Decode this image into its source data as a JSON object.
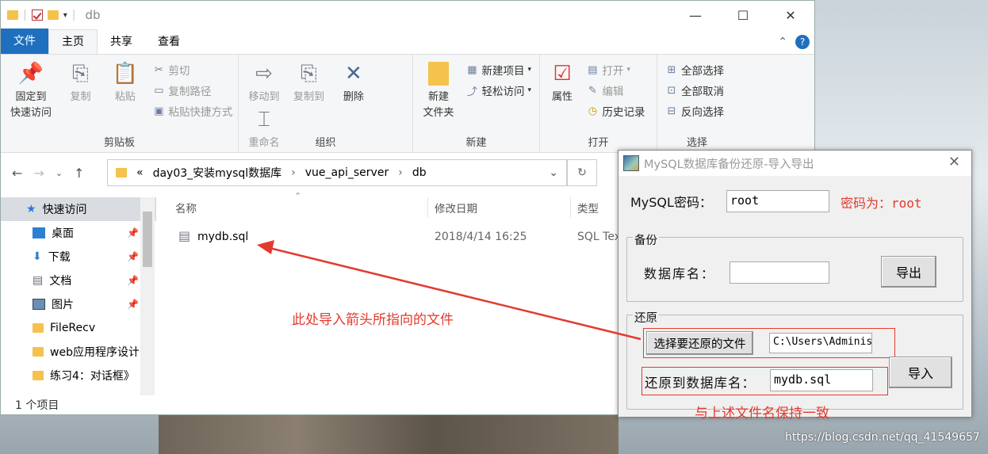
{
  "window": {
    "title": "db",
    "minimize": "—",
    "maximize": "☐",
    "close": "✕"
  },
  "ribbon_tabs": [
    "文件",
    "主页",
    "共享",
    "查看"
  ],
  "clipboard": {
    "pin": "固定到\n快速访问",
    "copy": "复制",
    "paste": "粘贴",
    "cut": "剪切",
    "copy_path": "复制路径",
    "paste_shortcut": "粘贴快捷方式",
    "label": "剪贴板"
  },
  "organize": {
    "move_to": "移动到",
    "copy_to": "复制到",
    "delete": "删除",
    "rename": "重命名",
    "label": "组织"
  },
  "new": {
    "new_folder": "新建\n文件夹",
    "new_item": "新建项目",
    "easy_access": "轻松访问",
    "label": "新建"
  },
  "open": {
    "properties": "属性",
    "open": "打开",
    "edit": "编辑",
    "history": "历史记录",
    "label": "打开"
  },
  "select": {
    "select_all": "全部选择",
    "select_none": "全部取消",
    "invert": "反向选择",
    "label": "选择"
  },
  "address": {
    "prefix": "«",
    "segments": [
      "day03_安装mysql数据库",
      "vue_api_server",
      "db"
    ]
  },
  "sidebar": [
    {
      "label": "快速访问",
      "icon": "star-icon",
      "pinned": false
    },
    {
      "label": "桌面",
      "icon": "desktop-icon",
      "pinned": true
    },
    {
      "label": "下载",
      "icon": "download-icon",
      "pinned": true
    },
    {
      "label": "文档",
      "icon": "document-icon",
      "pinned": true
    },
    {
      "label": "图片",
      "icon": "picture-icon",
      "pinned": true
    },
    {
      "label": "FileRecv",
      "icon": "folder-icon",
      "pinned": false
    },
    {
      "label": "web应用程序设计",
      "icon": "folder-icon",
      "pinned": false
    },
    {
      "label": "练习4：对话框》",
      "icon": "folder-icon",
      "pinned": false
    }
  ],
  "columns": {
    "name": "名称",
    "modified": "修改日期",
    "type": "类型"
  },
  "files": [
    {
      "name": "mydb.sql",
      "modified": "2018/4/14 16:25",
      "type": "SQL Tex"
    }
  ],
  "status": "1 个项目",
  "dialog": {
    "title": "MySQL数据库备份还原-导入导出",
    "password_label": "MySQL密码：",
    "password_value": "root",
    "password_note": "密码为：root",
    "backup_group": "备份",
    "db_name_label": "数据库名：",
    "db_name_value": "",
    "export_button": "导出",
    "restore_group": "还原",
    "choose_file_button": "选择要还原的文件",
    "file_path": "C:\\Users\\Administrat",
    "restore_db_label": "还原到数据库名：",
    "restore_db_value": "mydb.sql",
    "import_button": "导入"
  },
  "annotations": {
    "arrow_note": "此处导入箭头所指向的文件",
    "name_note": "与上述文件名保持一致",
    "color": "#e23b2e"
  },
  "watermark": "https://blog.csdn.net/qq_41549657"
}
